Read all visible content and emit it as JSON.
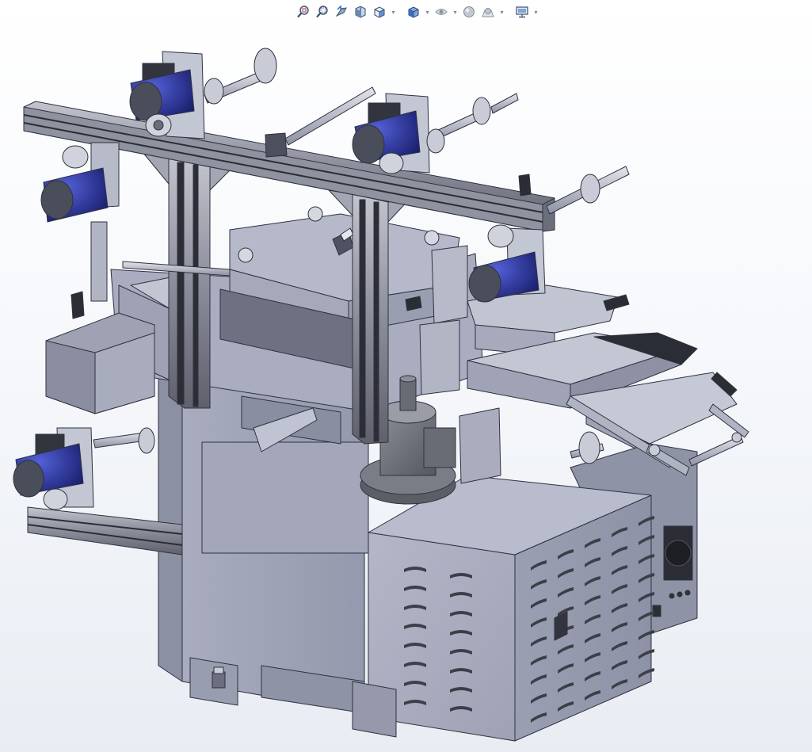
{
  "toolbar": {
    "items": [
      {
        "icon": "zoom-to-fit-icon",
        "dropdown": false
      },
      {
        "icon": "zoom-to-area-icon",
        "dropdown": false
      },
      {
        "icon": "previous-view-icon",
        "dropdown": false
      },
      {
        "icon": "section-view-icon",
        "dropdown": false
      },
      {
        "icon": "view-orientation-icon",
        "dropdown": true
      },
      {
        "icon": "display-style-icon",
        "dropdown": true
      },
      {
        "icon": "hide-show-items-icon",
        "dropdown": true
      },
      {
        "icon": "edit-appearance-icon",
        "dropdown": false
      },
      {
        "icon": "apply-scene-icon",
        "dropdown": true
      },
      {
        "icon": "view-settings-icon",
        "dropdown": true
      }
    ]
  },
  "model": {
    "name": "die-cutting-machine-assembly",
    "colors": {
      "metal_light": "#b9bdcc",
      "metal_mid": "#9fa3b5",
      "metal_dark": "#7c8094",
      "edge": "#2f3140",
      "motor_blue": "#2a34a8",
      "motor_blue_dark": "#151b66",
      "gearbox": "#4a4e5a",
      "extrusion": "#a3a6b3"
    }
  }
}
